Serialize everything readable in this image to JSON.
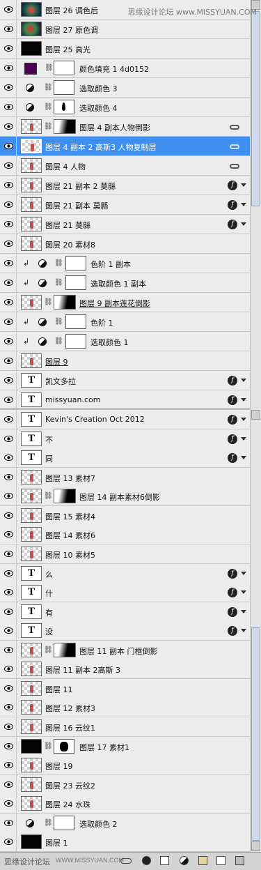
{
  "watermark": {
    "top": "思缘设计论坛 www.MISSYUAN.COM",
    "bottom": "思缘设计论坛",
    "bottom_url": "WWW.MISSYUAN.COM"
  },
  "colors": {
    "fill_swatch": "#4d0152",
    "selected_row": "#3e8ff0"
  },
  "layers": [
    {
      "name": "图层 26 调色后",
      "thumb": "teal"
    },
    {
      "name": "图层 27 原色调",
      "thumb": "green"
    },
    {
      "name": "图层 25 高光",
      "thumb": "dark"
    },
    {
      "name": "颜色填充 1 4d0152",
      "type": "fill"
    },
    {
      "name": "选取颜色 3",
      "type": "adjust"
    },
    {
      "name": "选取颜色 4",
      "type": "adjust",
      "mask": "leaf"
    },
    {
      "name": "图层 4 副本人物倒影",
      "mask": "grad",
      "link": true
    },
    {
      "name": "图层 4 副本 2 高斯3 人物复制层",
      "selected": true,
      "link": true
    },
    {
      "name": "图层 4 人物",
      "link": true
    },
    {
      "name": "图层 21 副本 2 莫縣",
      "fx": true
    },
    {
      "name": "图层 21 副本 莫縣",
      "fx": true
    },
    {
      "name": "图层 21 莫縣",
      "fx": true
    },
    {
      "name": "图层 20 素材8"
    },
    {
      "name": "色阶 1 副本",
      "type": "adjust",
      "clip": true
    },
    {
      "name": "选取颜色 1 副本",
      "type": "adjust",
      "clip": true
    },
    {
      "name": "图层 9 副本莲花倒影",
      "mask": "grad",
      "underline": true
    },
    {
      "name": "色阶 1",
      "type": "adjust",
      "clip": true
    },
    {
      "name": "选取颜色 1",
      "type": "adjust",
      "clip": true
    },
    {
      "name": "图层 9",
      "underline": true
    },
    {
      "name": "凯文多拉",
      "type": "text",
      "fx": true
    },
    {
      "name": "missyuan.com",
      "type": "text",
      "fx": true
    }
  ],
  "layers2": [
    {
      "name": "Kevin's Creation Oct 2012",
      "type": "text",
      "fx": true
    },
    {
      "name": "不",
      "type": "text",
      "fx": true
    },
    {
      "name": "同",
      "type": "text",
      "fx": true
    },
    {
      "name": "图层 13 素材7"
    },
    {
      "name": "图层 14 副本素材6倒影",
      "mask": "grad"
    },
    {
      "name": "图层 15 素材4"
    },
    {
      "name": "图层 14 素材6"
    },
    {
      "name": "图层 10 素材5"
    },
    {
      "name": "么",
      "type": "text",
      "fx": true
    },
    {
      "name": "什",
      "type": "text",
      "fx": true
    },
    {
      "name": "有",
      "type": "text",
      "fx": true
    },
    {
      "name": "没",
      "type": "text",
      "fx": true
    },
    {
      "name": "图层 11 副本 门框倒影",
      "mask": "grad"
    },
    {
      "name": "图层 11 副本 2高斯 3"
    },
    {
      "name": "图层 11"
    },
    {
      "name": "图层 12 素材3"
    },
    {
      "name": "图层 16 云纹1"
    },
    {
      "name": "图层 17 素材1",
      "thumb": "dark",
      "mask": "blob"
    },
    {
      "name": "图层 19"
    },
    {
      "name": "图层 23 云纹2"
    },
    {
      "name": "图层 24 水珠"
    },
    {
      "name": "选取颜色 2",
      "type": "adjust"
    },
    {
      "name": "图层 1",
      "thumb": "dark"
    }
  ]
}
